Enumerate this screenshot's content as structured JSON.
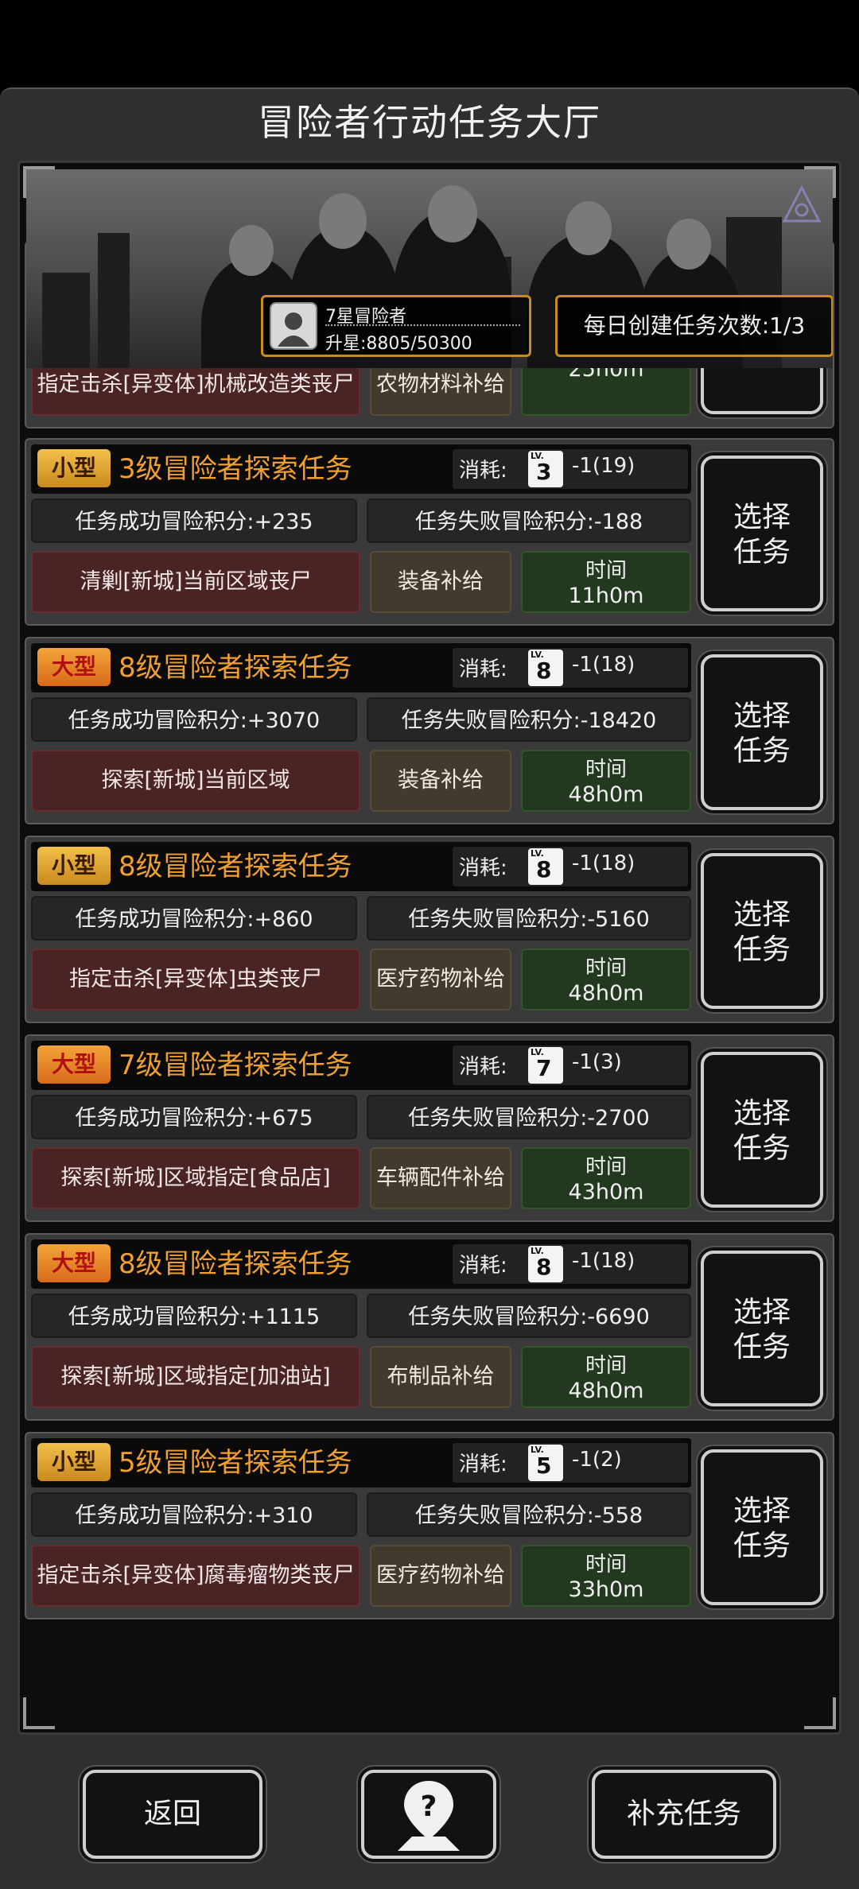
{
  "header": {
    "title": "冒险者行动任务大厅"
  },
  "rank": {
    "name": "7星冒险者",
    "progress": "升星:8805/50300",
    "avatar_icon": "adventurer-avatar-icon"
  },
  "daily": {
    "label": "每日创建任务次数:1/3"
  },
  "partial_card": {
    "target": "指定击杀[异变体]机械改造类丧尸",
    "supply": "农物材料补给",
    "time": "25h0m"
  },
  "missions": [
    {
      "size": "小型",
      "title": "3级冒险者探索任务",
      "cost_label": "消耗:",
      "cost_lv": "LV.",
      "cost_num": "3",
      "cost_val": "-1(19)",
      "success": "任务成功冒险积分:+235",
      "fail": "任务失败冒险积分:-188",
      "target": "清剿[新城]当前区域丧尸",
      "supply": "装备补给",
      "time_label": "时间",
      "time": "11h0m",
      "select": "选择任务"
    },
    {
      "size": "大型",
      "title": "8级冒险者探索任务",
      "cost_label": "消耗:",
      "cost_lv": "LV.",
      "cost_num": "8",
      "cost_val": "-1(18)",
      "success": "任务成功冒险积分:+3070",
      "fail": "任务失败冒险积分:-18420",
      "target": "探索[新城]当前区域",
      "supply": "装备补给",
      "time_label": "时间",
      "time": "48h0m",
      "select": "选择任务"
    },
    {
      "size": "小型",
      "title": "8级冒险者探索任务",
      "cost_label": "消耗:",
      "cost_lv": "LV.",
      "cost_num": "8",
      "cost_val": "-1(18)",
      "success": "任务成功冒险积分:+860",
      "fail": "任务失败冒险积分:-5160",
      "target": "指定击杀[异变体]虫类丧尸",
      "supply": "医疗药物补给",
      "time_label": "时间",
      "time": "48h0m",
      "select": "选择任务"
    },
    {
      "size": "大型",
      "title": "7级冒险者探索任务",
      "cost_label": "消耗:",
      "cost_lv": "LV.",
      "cost_num": "7",
      "cost_val": "-1(3)",
      "success": "任务成功冒险积分:+675",
      "fail": "任务失败冒险积分:-2700",
      "target": "探索[新城]区域指定[食品店]",
      "supply": "车辆配件补给",
      "time_label": "时间",
      "time": "43h0m",
      "select": "选择任务"
    },
    {
      "size": "大型",
      "title": "8级冒险者探索任务",
      "cost_label": "消耗:",
      "cost_lv": "LV.",
      "cost_num": "8",
      "cost_val": "-1(18)",
      "success": "任务成功冒险积分:+1115",
      "fail": "任务失败冒险积分:-6690",
      "target": "探索[新城]区域指定[加油站]",
      "supply": "布制品补给",
      "time_label": "时间",
      "time": "48h0m",
      "select": "选择任务"
    },
    {
      "size": "小型",
      "title": "5级冒险者探索任务",
      "cost_label": "消耗:",
      "cost_lv": "LV.",
      "cost_num": "5",
      "cost_val": "-1(2)",
      "success": "任务成功冒险积分:+310",
      "fail": "任务失败冒险积分:-558",
      "target": "指定击杀[异变体]腐毒瘤物类丧尸",
      "supply": "医疗药物补给",
      "time_label": "时间",
      "time": "33h0m",
      "select": "选择任务"
    }
  ],
  "footer": {
    "back": "返回",
    "help_icon": "help-map-pin-icon",
    "add": "补充任务"
  }
}
